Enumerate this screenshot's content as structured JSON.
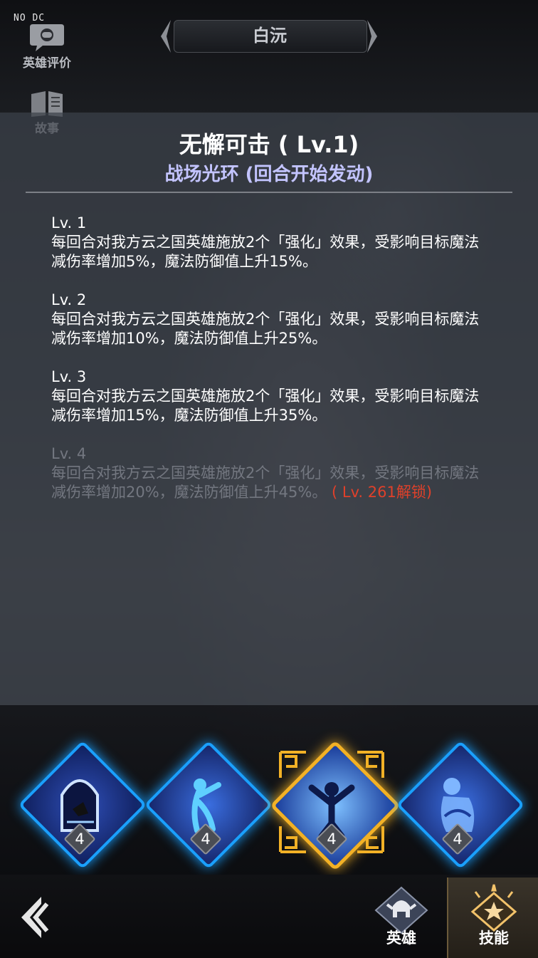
{
  "overlay_text": "NO DC",
  "side_buttons": [
    {
      "label": "英雄评价",
      "icon": "chat-bubble-icon"
    },
    {
      "label": "故事",
      "icon": "book-icon"
    }
  ],
  "hero_name": "白沅",
  "skill": {
    "title": "无懈可击 ( Lv.1)",
    "type": "战场光环 (回合开始发动)"
  },
  "levels": [
    {
      "name": "Lv. 1",
      "desc": "每回合对我方云之国英雄施放2个「强化」效果，受影响目标魔法减伤率增加5%，魔法防御值上升15%。",
      "locked": false
    },
    {
      "name": "Lv. 2",
      "desc": "每回合对我方云之国英雄施放2个「强化」效果，受影响目标魔法减伤率增加10%，魔法防御值上升25%。",
      "locked": false
    },
    {
      "name": "Lv. 3",
      "desc": "每回合对我方云之国英雄施放2个「强化」效果，受影响目标魔法减伤率增加15%，魔法防御值上升35%。",
      "locked": false
    },
    {
      "name": "Lv. 4",
      "desc": "每回合对我方云之国英雄施放2个「强化」效果，受影响目标魔法减伤率增加20%，魔法防御值上升45%。",
      "locked": true,
      "unlock": " ( Lv. 261解锁)"
    }
  ],
  "skill_slots": [
    {
      "level": "4",
      "icon": "shattered-portal-icon",
      "selected": false
    },
    {
      "level": "4",
      "icon": "dancing-figure-icon",
      "selected": false
    },
    {
      "level": "4",
      "icon": "burst-figure-icon",
      "selected": true
    },
    {
      "level": "4",
      "icon": "embrace-figure-icon",
      "selected": false
    }
  ],
  "tabs": [
    {
      "label": "英雄",
      "icon": "helmet-icon",
      "active": false
    },
    {
      "label": "技能",
      "icon": "skill-star-icon",
      "active": true
    }
  ],
  "colors": {
    "skill_type": "#c3c4ff",
    "unlock_red": "#e0402a",
    "slot_glow": "#1aa0ff",
    "selected_gold": "#f2b126"
  }
}
